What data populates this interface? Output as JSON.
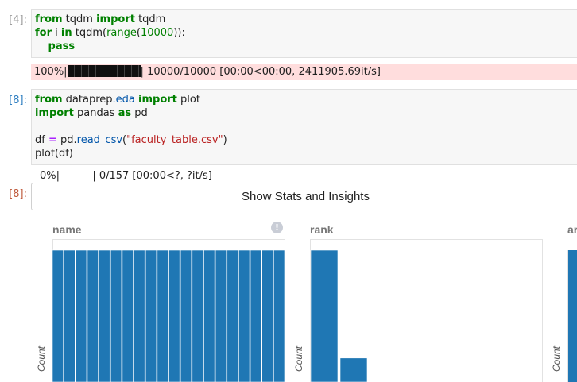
{
  "cells": [
    {
      "prompt": "[4]:",
      "lines": [
        [
          {
            "t": "from",
            "c": "kw"
          },
          {
            "t": " tqdm ",
            "c": ""
          },
          {
            "t": "import",
            "c": "kw"
          },
          {
            "t": " tqdm",
            "c": ""
          }
        ],
        [
          {
            "t": "for",
            "c": "kw"
          },
          {
            "t": " i ",
            "c": ""
          },
          {
            "t": "in",
            "c": "kw"
          },
          {
            "t": " tqdm(",
            "c": ""
          },
          {
            "t": "range",
            "c": "num"
          },
          {
            "t": "(",
            "c": ""
          },
          {
            "t": "10000",
            "c": "num"
          },
          {
            "t": ")):",
            "c": ""
          }
        ],
        [
          {
            "t": "    ",
            "c": ""
          },
          {
            "t": "pass",
            "c": "kw"
          }
        ]
      ]
    },
    {
      "prompt": "[8]:",
      "lines": [
        [
          {
            "t": "from",
            "c": "kw"
          },
          {
            "t": " dataprep",
            "c": ""
          },
          {
            "t": ".eda",
            "c": "attr"
          },
          {
            "t": " ",
            "c": ""
          },
          {
            "t": "import",
            "c": "kw"
          },
          {
            "t": " plot",
            "c": ""
          }
        ],
        [
          {
            "t": "import",
            "c": "kw"
          },
          {
            "t": " pandas ",
            "c": ""
          },
          {
            "t": "as",
            "c": "kw"
          },
          {
            "t": " pd",
            "c": ""
          }
        ],
        [],
        [
          {
            "t": "df ",
            "c": ""
          },
          {
            "t": "=",
            "c": "op"
          },
          {
            "t": " pd.",
            "c": ""
          },
          {
            "t": "read_csv",
            "c": "attr"
          },
          {
            "t": "(",
            "c": ""
          },
          {
            "t": "\"faculty_table.csv\"",
            "c": "str"
          },
          {
            "t": ")",
            "c": ""
          }
        ],
        [
          {
            "t": "plot(df)",
            "c": ""
          }
        ]
      ]
    }
  ],
  "stderr_output": {
    "prefix": "100%|",
    "suffix": "| 10000/10000 [00:00<00:00, 2411905.69it/s]"
  },
  "progress_output": "0%|          | 0/157 [00:00<?, ?it/s]",
  "output_prompt": "[8]:",
  "stats_button_label": "Show Stats and Insights",
  "charts": [
    {
      "title": "name",
      "ylabel": "Count",
      "values": [
        1,
        1,
        1,
        1,
        1,
        1,
        1,
        1,
        1,
        1,
        1,
        1,
        1,
        1,
        1,
        1,
        1,
        1,
        1,
        1
      ]
    },
    {
      "title": "rank",
      "ylabel": "Count",
      "values": [
        5.5,
        1
      ]
    },
    {
      "title": "ar",
      "ylabel": "Count"
    }
  ],
  "colors": {
    "bar": "#1f77b4",
    "stderr_bg": "#ffdddd"
  }
}
